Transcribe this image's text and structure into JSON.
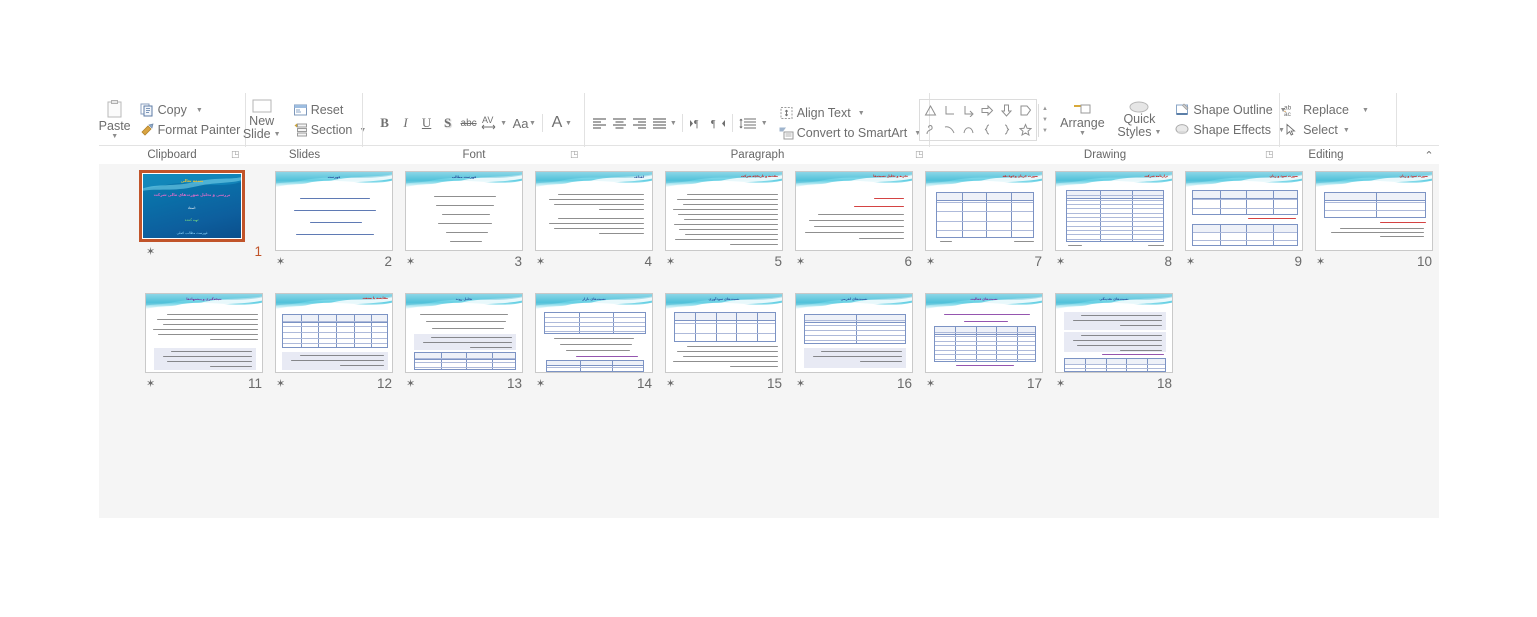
{
  "app": "PowerPoint Slide Sorter",
  "ribbon": {
    "collapse_icon": "chevron-up-icon",
    "groups": [
      {
        "name": "Clipboard",
        "label": "Clipboard",
        "dialog_launcher": true,
        "items": [
          {
            "label": "Paste",
            "icon": "paste-icon",
            "caret": true
          },
          {
            "label": "Copy",
            "icon": "copy-icon",
            "caret": true
          },
          {
            "label": "Format Painter",
            "icon": "format-painter-icon",
            "caret": false
          }
        ]
      },
      {
        "name": "Slides",
        "label": "Slides",
        "dialog_launcher": false,
        "items": [
          {
            "label": "New Slide",
            "icon": "new-slide-icon",
            "caret": true
          },
          {
            "label": "Reset",
            "icon": "reset-icon",
            "caret": false
          },
          {
            "label": "Section",
            "icon": "section-icon",
            "caret": true
          }
        ]
      },
      {
        "name": "Font",
        "label": "Font",
        "dialog_launcher": true,
        "items": [
          {
            "label": "B",
            "icon": "bold-icon"
          },
          {
            "label": "I",
            "icon": "italic-icon"
          },
          {
            "label": "U",
            "icon": "underline-icon"
          },
          {
            "label": "S",
            "icon": "text-shadow-icon"
          },
          {
            "label": "abc",
            "icon": "strikethrough-icon"
          },
          {
            "label": "AV",
            "icon": "character-spacing-icon",
            "caret": true
          },
          {
            "label": "Aa",
            "icon": "change-case-icon",
            "caret": true
          },
          {
            "label": "A",
            "icon": "font-color-icon",
            "caret": true
          }
        ]
      },
      {
        "name": "Paragraph",
        "label": "Paragraph",
        "dialog_launcher": true,
        "items": [
          {
            "label": "Align Left",
            "icon": "align-left-icon"
          },
          {
            "label": "Center",
            "icon": "align-center-icon"
          },
          {
            "label": "Align Right",
            "icon": "align-right-icon"
          },
          {
            "label": "Justify",
            "icon": "justify-icon",
            "caret": true
          },
          {
            "label": "Left-to-Right",
            "icon": "ltr-text-direction-icon"
          },
          {
            "label": "Right-to-Left",
            "icon": "rtl-text-direction-icon"
          },
          {
            "label": "Line Spacing",
            "icon": "line-spacing-icon",
            "caret": true
          },
          {
            "label": "Align Text",
            "icon": "align-text-icon",
            "caret": true
          },
          {
            "label": "Convert to SmartArt",
            "icon": "convert-to-smartart-icon",
            "caret": true
          }
        ]
      },
      {
        "name": "Drawing",
        "label": "Drawing",
        "dialog_launcher": true,
        "items": [
          {
            "label": "Shapes Gallery",
            "icon": "shapes-gallery-icon"
          },
          {
            "label": "Arrange",
            "icon": "arrange-icon",
            "caret": true
          },
          {
            "label": "Quick Styles",
            "icon": "quick-styles-icon",
            "caret": true
          },
          {
            "label": "Shape Outline",
            "icon": "shape-outline-icon",
            "caret": true
          },
          {
            "label": "Shape Effects",
            "icon": "shape-effects-icon",
            "caret": true
          }
        ],
        "shape_glyphs_row1": [
          "triangle",
          "corner",
          "corner-arrow",
          "right-arrow",
          "down-arrow",
          "pentagon"
        ],
        "shape_glyphs_row2": [
          "freeform",
          "curve-up",
          "arc",
          "left-brace",
          "right-brace",
          "star"
        ]
      },
      {
        "name": "Editing",
        "label": "Editing",
        "dialog_launcher": false,
        "items": [
          {
            "label": "Replace",
            "icon": "replace-icon",
            "caret": true
          },
          {
            "label": "Select",
            "icon": "select-icon",
            "caret": true
          }
        ]
      }
    ]
  },
  "sorter": {
    "animation_star": "✶",
    "selected_slide": 1,
    "rows": [
      {
        "slides": [
          {
            "number": "10",
            "star": "✶",
            "kind": "table-note",
            "selected": false
          },
          {
            "number": "9",
            "star": "✶",
            "kind": "double-table",
            "selected": false
          },
          {
            "number": "8",
            "star": "✶",
            "kind": "long-table",
            "selected": false
          },
          {
            "number": "7",
            "star": "✶",
            "kind": "short-table",
            "selected": false
          },
          {
            "number": "6",
            "star": "✶",
            "kind": "red-bullets",
            "selected": false
          },
          {
            "number": "5",
            "star": "✶",
            "kind": "dense-text",
            "selected": false
          },
          {
            "number": "4",
            "star": "✶",
            "kind": "bullet-paragraphs",
            "selected": false
          },
          {
            "number": "3",
            "star": "✶",
            "kind": "centered-list",
            "selected": false
          },
          {
            "number": "2",
            "star": "✶",
            "kind": "agenda-list",
            "selected": false
          },
          {
            "number": "1",
            "star": "✶",
            "kind": "title-slide",
            "selected": true
          }
        ]
      },
      {
        "slides": [
          {
            "number": "18",
            "star": "✶",
            "kind": "panel-table",
            "selected": false
          },
          {
            "number": "17",
            "star": "✶",
            "kind": "matrix-table",
            "selected": false
          },
          {
            "number": "16",
            "star": "✶",
            "kind": "two-col-table",
            "selected": false
          },
          {
            "number": "15",
            "star": "✶",
            "kind": "table-paragraph",
            "selected": false
          },
          {
            "number": "14",
            "star": "✶",
            "kind": "table-plus-list",
            "selected": false
          },
          {
            "number": "13",
            "star": "✶",
            "kind": "list-table",
            "selected": false
          },
          {
            "number": "12",
            "star": "✶",
            "kind": "wide-table",
            "selected": false
          },
          {
            "number": "11",
            "star": "✶",
            "kind": "text-table",
            "selected": false
          }
        ]
      }
    ]
  }
}
